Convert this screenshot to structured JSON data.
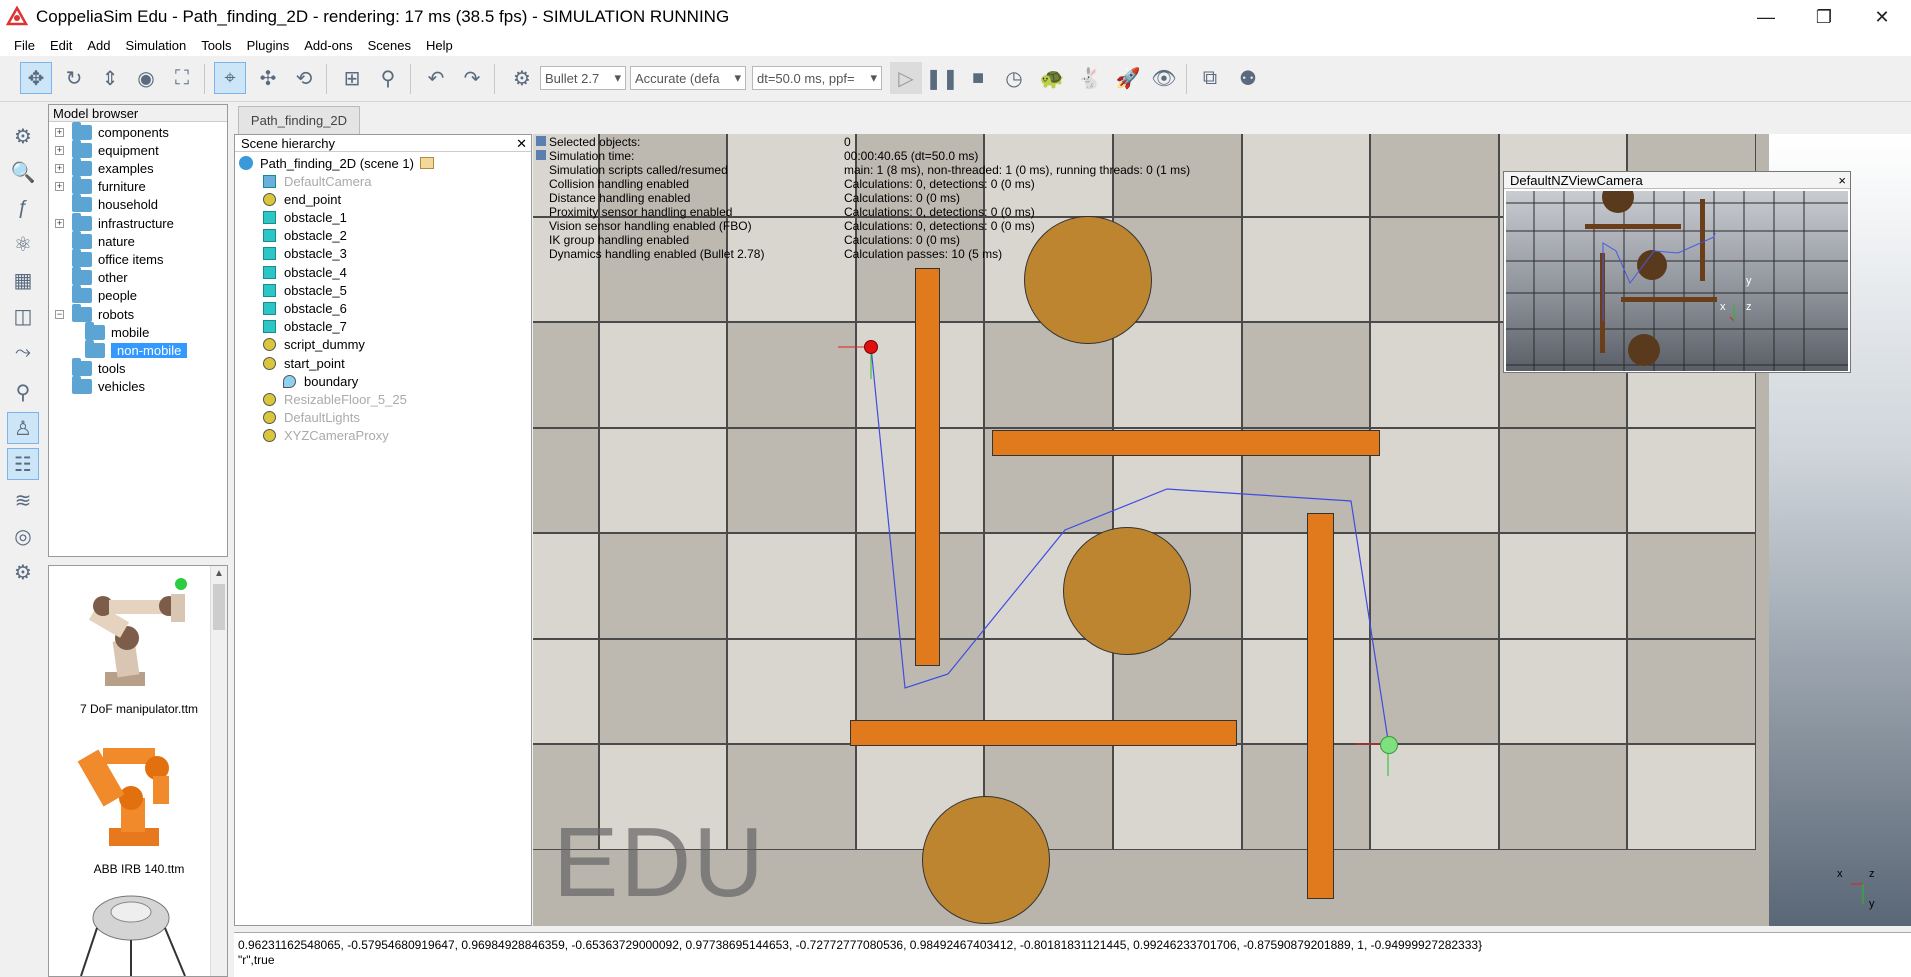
{
  "window": {
    "title": "CoppeliaSim Edu - Path_finding_2D - rendering: 17 ms (38.5 fps) - SIMULATION RUNNING",
    "minimize": "—",
    "restore": "❐",
    "close": "✕"
  },
  "menu": [
    "File",
    "Edit",
    "Add",
    "Simulation",
    "Tools",
    "Plugins",
    "Add-ons",
    "Scenes",
    "Help"
  ],
  "toolbar": {
    "engine": "Bullet 2.7",
    "accuracy": "Accurate (defa",
    "timestep": "dt=50.0 ms, ppf="
  },
  "model_browser": {
    "header": "Model browser",
    "items": [
      {
        "label": "components",
        "expander": "+"
      },
      {
        "label": "equipment",
        "expander": "+"
      },
      {
        "label": "examples",
        "expander": "+"
      },
      {
        "label": "furniture",
        "expander": "+"
      },
      {
        "label": "household",
        "expander": ""
      },
      {
        "label": "infrastructure",
        "expander": "+"
      },
      {
        "label": "nature",
        "expander": ""
      },
      {
        "label": "office items",
        "expander": ""
      },
      {
        "label": "other",
        "expander": ""
      },
      {
        "label": "people",
        "expander": ""
      },
      {
        "label": "robots",
        "expander": "−"
      },
      {
        "label": "mobile",
        "expander": ""
      },
      {
        "label": "non-mobile",
        "expander": ""
      },
      {
        "label": "tools",
        "expander": ""
      },
      {
        "label": "vehicles",
        "expander": ""
      }
    ],
    "thumbnails": [
      "7 DoF manipulator.ttm",
      "ABB IRB 140.ttm"
    ]
  },
  "scene_tab": "Path_finding_2D",
  "hierarchy": {
    "header": "Scene hierarchy",
    "root": "Path_finding_2D (scene 1)",
    "items": [
      "DefaultCamera",
      "end_point",
      "obstacle_1",
      "obstacle_2",
      "obstacle_3",
      "obstacle_4",
      "obstacle_5",
      "obstacle_6",
      "obstacle_7",
      "script_dummy",
      "start_point",
      "boundary",
      "ResizableFloor_5_25",
      "DefaultLights",
      "XYZCameraProxy"
    ]
  },
  "sim_info": [
    {
      "k": "Selected objects:",
      "v": "0"
    },
    {
      "k": "Simulation time:",
      "v": "00:00:40.65 (dt=50.0 ms)"
    },
    {
      "k": "Simulation scripts called/resumed",
      "v": "main: 1 (8 ms), non-threaded: 1 (0 ms), running threads: 0 (1 ms)"
    },
    {
      "k": "Collision handling enabled",
      "v": "Calculations: 0, detections: 0 (0 ms)"
    },
    {
      "k": "Distance handling enabled",
      "v": "Calculations: 0 (0 ms)"
    },
    {
      "k": "Proximity sensor handling enabled",
      "v": "Calculations: 0, detections: 0 (0 ms)"
    },
    {
      "k": "Vision sensor handling enabled (FBO)",
      "v": "Calculations: 0, detections: 0 (0 ms)"
    },
    {
      "k": "IK group handling enabled",
      "v": "Calculations: 0 (0 ms)"
    },
    {
      "k": "Dynamics handling enabled (Bullet 2.78)",
      "v": "Calculation passes: 10 (5 ms)"
    }
  ],
  "watermark": "EDU",
  "subview": {
    "title": "DefaultNZViewCamera",
    "close": "×",
    "axis_y": "y",
    "axis_x": "x",
    "axis_z": "z"
  },
  "axes": {
    "x": "x",
    "z": "z",
    "y": "y"
  },
  "status": {
    "line1": "0.96231162548065, -0.57954680919647, 0.96984928846359, -0.65363729000092, 0.97738695144653, -0.72772777080536, 0.98492467403412, -0.80181831121445, 0.99246233701706, -0.87590879201889, 1, -0.94999927282333}",
    "line2": "\"r\",true"
  }
}
